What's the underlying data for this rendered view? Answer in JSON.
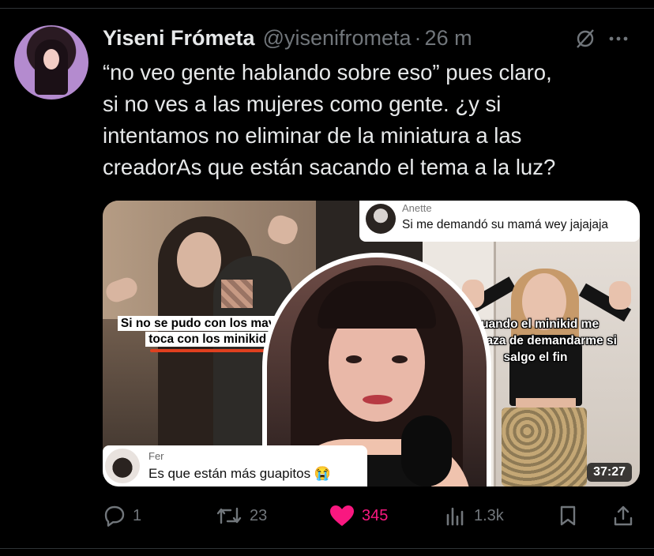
{
  "tweet": {
    "author_name": "Yiseni Frómeta",
    "handle": "@yisenifrometa",
    "separator": "·",
    "time": "26 m",
    "text_lines": [
      "“no veo gente hablando sobre eso” pues claro,",
      "si no ves a las mujeres como gente. ¿y si",
      "intentamos no eliminar de la miniatura a las",
      "creadorAs que están sacando el tema a la luz?"
    ]
  },
  "media": {
    "left_caption_line1": "Si no se pudo con los mayores",
    "left_caption_line2": "toca con los minikids",
    "right_caption": "Cuando el minikid me amenaza de demandarme si salgo el fin",
    "comment_top": {
      "name": "Anette",
      "text": "Si me demandó su mamá wey jajajaja"
    },
    "comment_bottom": {
      "name": "Fer",
      "text": "Es que están más guapitos 😭"
    },
    "duration": "37:27"
  },
  "actions": {
    "reply_count": "1",
    "retweet_count": "23",
    "like_count": "345",
    "views_count": "1.3k",
    "icons": [
      "reply-icon",
      "retweet-icon",
      "heart-icon",
      "views-icon",
      "bookmark-icon",
      "share-icon"
    ],
    "like_color": "#f91880",
    "muted_color": "#71767b"
  },
  "header_icons": [
    "grok-icon",
    "more-icon"
  ]
}
